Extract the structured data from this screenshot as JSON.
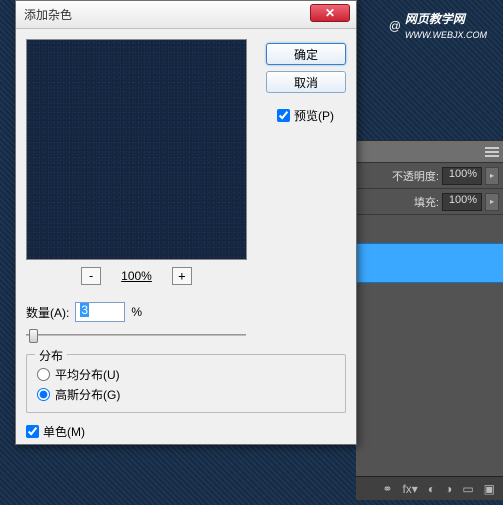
{
  "watermark": {
    "cn": "网页教学网",
    "en": "WWW.WEBJX.COM"
  },
  "layers": {
    "opacity_label": "不透明度:",
    "opacity_value": "100%",
    "fill_label": "填充:",
    "fill_value": "100%"
  },
  "dialog": {
    "title": "添加杂色",
    "ok": "确定",
    "cancel": "取消",
    "preview_label": "预览(P)",
    "zoom": {
      "out": "-",
      "level": "100%",
      "in": "+"
    },
    "amount_label": "数量(A):",
    "amount_value": "3",
    "amount_suffix": "%",
    "distribution": {
      "title": "分布",
      "uniform": "平均分布(U)",
      "gaussian": "高斯分布(G)"
    },
    "monochrome": "单色(M)"
  }
}
